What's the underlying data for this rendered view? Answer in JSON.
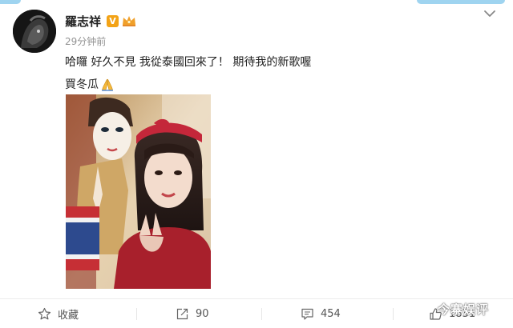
{
  "post": {
    "author": "羅志祥",
    "time": "29分钟前",
    "text_line1": "哈囉 好久不見 我從泰國回來了！ 期待我的新歌喔",
    "text_line2": "買冬瓜"
  },
  "badges": {
    "verified": "V"
  },
  "icons": {
    "menu": "chevron-down-icon",
    "favorite": "star-icon",
    "repost": "share-icon",
    "comment": "comment-icon",
    "like": "thumbs-up-icon",
    "emoji": "praying-hands-icon"
  },
  "actions": {
    "favorite_label": "收藏",
    "repost_count": "90",
    "comment_count": "454",
    "like_count": "1831"
  },
  "watermark": "今寨娱评",
  "colors": {
    "accent": "#f3a316",
    "text": "#222222",
    "muted": "#939393",
    "strip": "#9fd4f0"
  }
}
